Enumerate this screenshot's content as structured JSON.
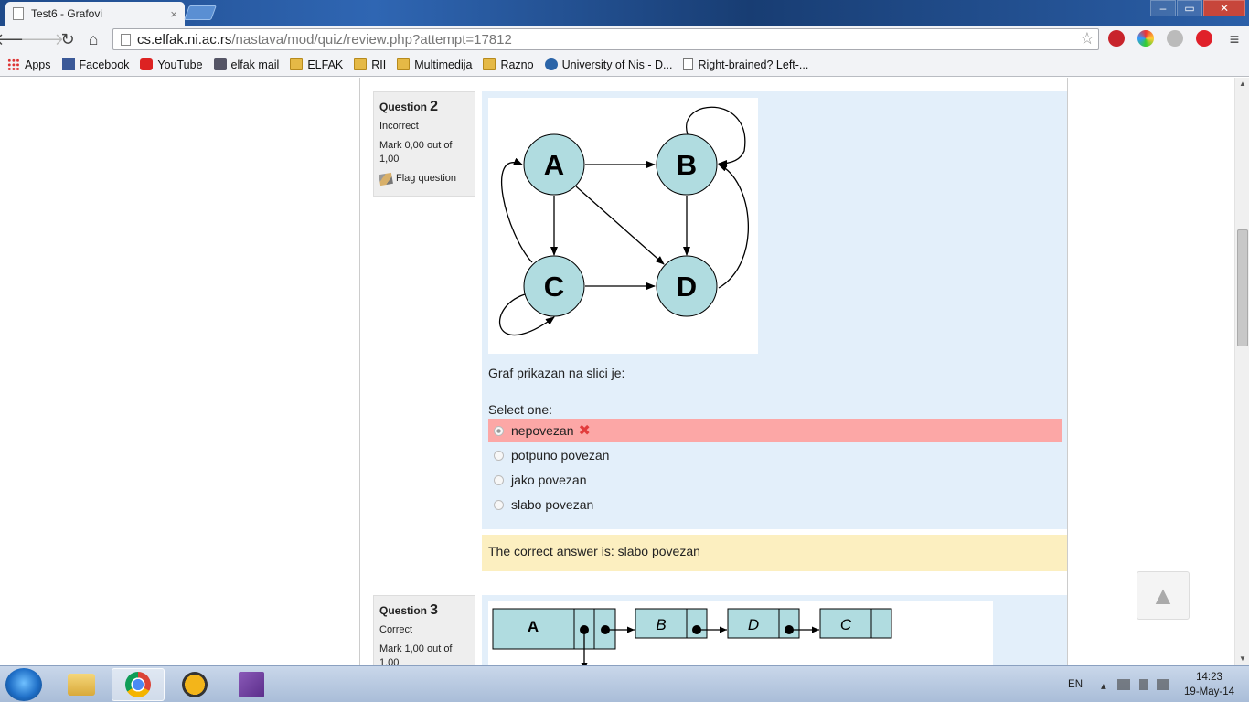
{
  "browser": {
    "tab_title": "Test6 - Grafovi",
    "tab_close": "×",
    "url_host": "cs.elfak.ni.ac.rs",
    "url_path": "/nastava/mod/quiz/review.php?attempt=17812",
    "window_controls": [
      "–",
      "▭",
      "✕"
    ]
  },
  "bookmarks": [
    {
      "label": "Apps",
      "icon": "apps-icon"
    },
    {
      "label": "Facebook",
      "icon": "facebook-icon"
    },
    {
      "label": "YouTube",
      "icon": "youtube-icon"
    },
    {
      "label": "elfak mail",
      "icon": "mail-icon"
    },
    {
      "label": "ELFAK",
      "icon": "folder-icon"
    },
    {
      "label": "RII",
      "icon": "folder-icon"
    },
    {
      "label": "Multimedija",
      "icon": "folder-icon"
    },
    {
      "label": "Razno",
      "icon": "folder-icon"
    },
    {
      "label": "University of Nis - D...",
      "icon": "university-icon"
    },
    {
      "label": "Right-brained? Left-...",
      "icon": "page-icon"
    }
  ],
  "question2": {
    "label": "Question",
    "number": "2",
    "state": "Incorrect",
    "grade": "Mark 0,00 out of 1,00",
    "flag": "Flag question",
    "graph_nodes": [
      "A",
      "B",
      "C",
      "D"
    ],
    "prompt": "Graf prikazan na slici je:",
    "select_one": "Select one:",
    "answers": [
      {
        "text": "nepovezan",
        "selected": true,
        "status": "incorrect"
      },
      {
        "text": "potpuno povezan",
        "selected": false
      },
      {
        "text": "jako povezan",
        "selected": false
      },
      {
        "text": "slabo povezan",
        "selected": false
      }
    ],
    "incorrect_mark": "✖",
    "feedback": "The correct answer is: slabo povezan"
  },
  "question3": {
    "label": "Question",
    "number": "3",
    "state": "Correct",
    "grade": "Mark 1,00 out of 1,00",
    "list_nodes": [
      "A",
      "B",
      "D",
      "C"
    ]
  },
  "back_to_top": "▲",
  "taskbar": {
    "lang": "EN",
    "time": "14:23",
    "date": "19-May-14"
  },
  "colors": {
    "question_bg": "#e3effa",
    "incorrect_bg": "#fca7a6",
    "feedback_bg": "#fcefc0",
    "node_fill": "#b0dce0"
  }
}
